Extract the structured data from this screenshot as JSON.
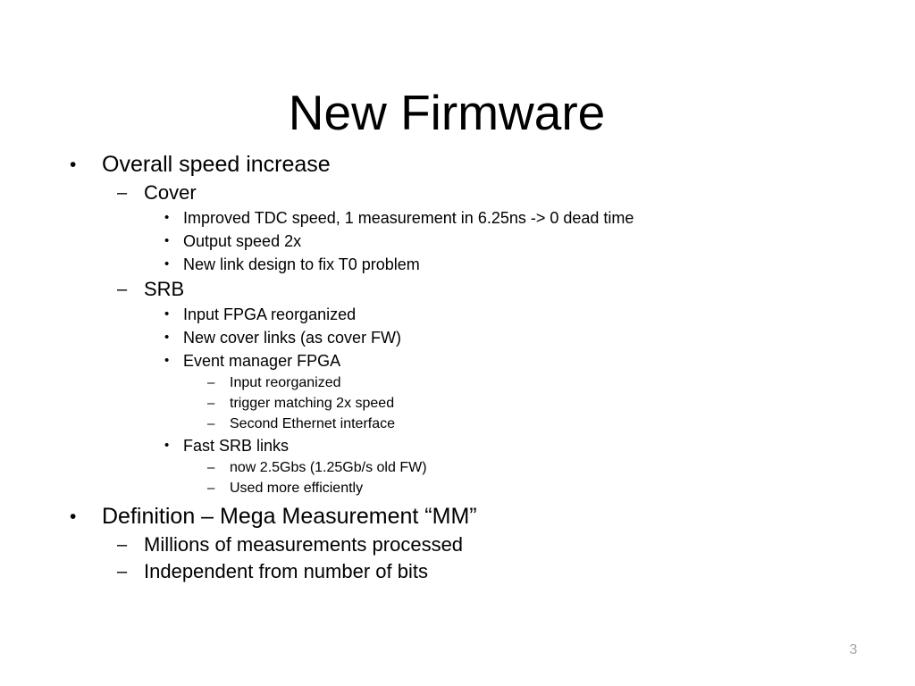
{
  "slide": {
    "title": "New Firmware",
    "page_number": "3",
    "background_color": "#ffffff",
    "text_color": "#000000",
    "page_number_color": "#a6a6a6",
    "bullet_glyph_level1": "•",
    "bullet_glyph_level2": "–",
    "bullet_glyph_level3": "•",
    "bullet_glyph_level4": "–"
  },
  "outline": [
    {
      "level": 1,
      "text": "Overall speed increase"
    },
    {
      "level": 2,
      "text": "Cover"
    },
    {
      "level": 3,
      "text": "Improved TDC speed, 1 measurement in 6.25ns -> 0 dead time"
    },
    {
      "level": 3,
      "text": "Output speed 2x"
    },
    {
      "level": 3,
      "text": "New link design to fix T0 problem"
    },
    {
      "level": 2,
      "text": "SRB"
    },
    {
      "level": 3,
      "text": "Input FPGA reorganized"
    },
    {
      "level": 3,
      "text": "New cover links (as cover FW)"
    },
    {
      "level": 3,
      "text": "Event manager FPGA"
    },
    {
      "level": 4,
      "text": "Input reorganized"
    },
    {
      "level": 4,
      "text": "trigger matching 2x speed"
    },
    {
      "level": 4,
      "text": "Second Ethernet interface"
    },
    {
      "level": 3,
      "text": "Fast SRB links"
    },
    {
      "level": 4,
      "text": "now 2.5Gbs (1.25Gb/s old FW)"
    },
    {
      "level": 4,
      "text": "Used more efficiently"
    },
    {
      "level": 1,
      "text": "Definition – Mega Measurement “MM”"
    },
    {
      "level": 2,
      "text": "Millions of measurements processed"
    },
    {
      "level": 2,
      "text": "Independent from number of bits"
    }
  ]
}
